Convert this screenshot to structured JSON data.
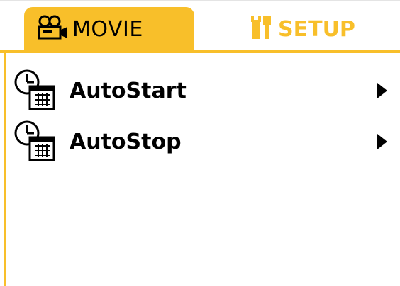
{
  "tabs": [
    {
      "label": "MOVIE",
      "icon": "movie-camera-icon",
      "selected": true
    },
    {
      "label": "SETUP",
      "icon": "tools-icon",
      "selected": false
    }
  ],
  "menu": {
    "items": [
      {
        "label": "AutoStart",
        "icon": "clock-calendar-icon",
        "arrow": "submenu-arrow-icon"
      },
      {
        "label": "AutoStop",
        "icon": "clock-calendar-icon",
        "arrow": "submenu-arrow-icon"
      }
    ]
  },
  "colors": {
    "accent": "#f8bf2a",
    "text": "#000000",
    "background": "#ffffff"
  }
}
